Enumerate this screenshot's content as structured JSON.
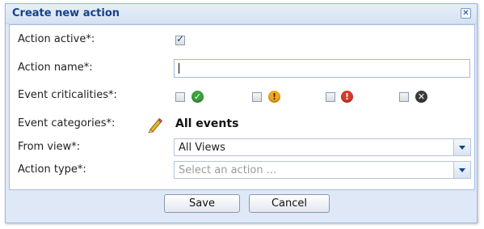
{
  "dialog": {
    "title": "Create new action",
    "close_glyph": "✕"
  },
  "form": {
    "action_active": {
      "label": "Action active*:",
      "checked": true
    },
    "action_name": {
      "label": "Action name*:",
      "value": ""
    },
    "event_criticalities": {
      "label": "Event criticalities*:",
      "items": [
        {
          "icon": "ok-status-icon",
          "glyph": "✓",
          "color": "#3da03d"
        },
        {
          "icon": "warning-status-icon",
          "glyph": "!",
          "color": "#f0a91a"
        },
        {
          "icon": "critical-status-icon",
          "glyph": "!",
          "color": "#d93a2c"
        },
        {
          "icon": "unknown-status-icon",
          "glyph": "✕",
          "color": "#3b3b3b"
        }
      ]
    },
    "event_categories": {
      "label": "Event categories*:",
      "value": "All events",
      "edit_icon": "pencil-icon"
    },
    "from_view": {
      "label": "From view*:",
      "value": "All Views"
    },
    "action_type": {
      "label": "Action type*:",
      "placeholder": "Select an action ..."
    }
  },
  "buttons": {
    "save": "Save",
    "cancel": "Cancel"
  },
  "colors": {
    "title": "#15428b",
    "frame": "#dfe8f6",
    "border": "#99bbe8"
  }
}
